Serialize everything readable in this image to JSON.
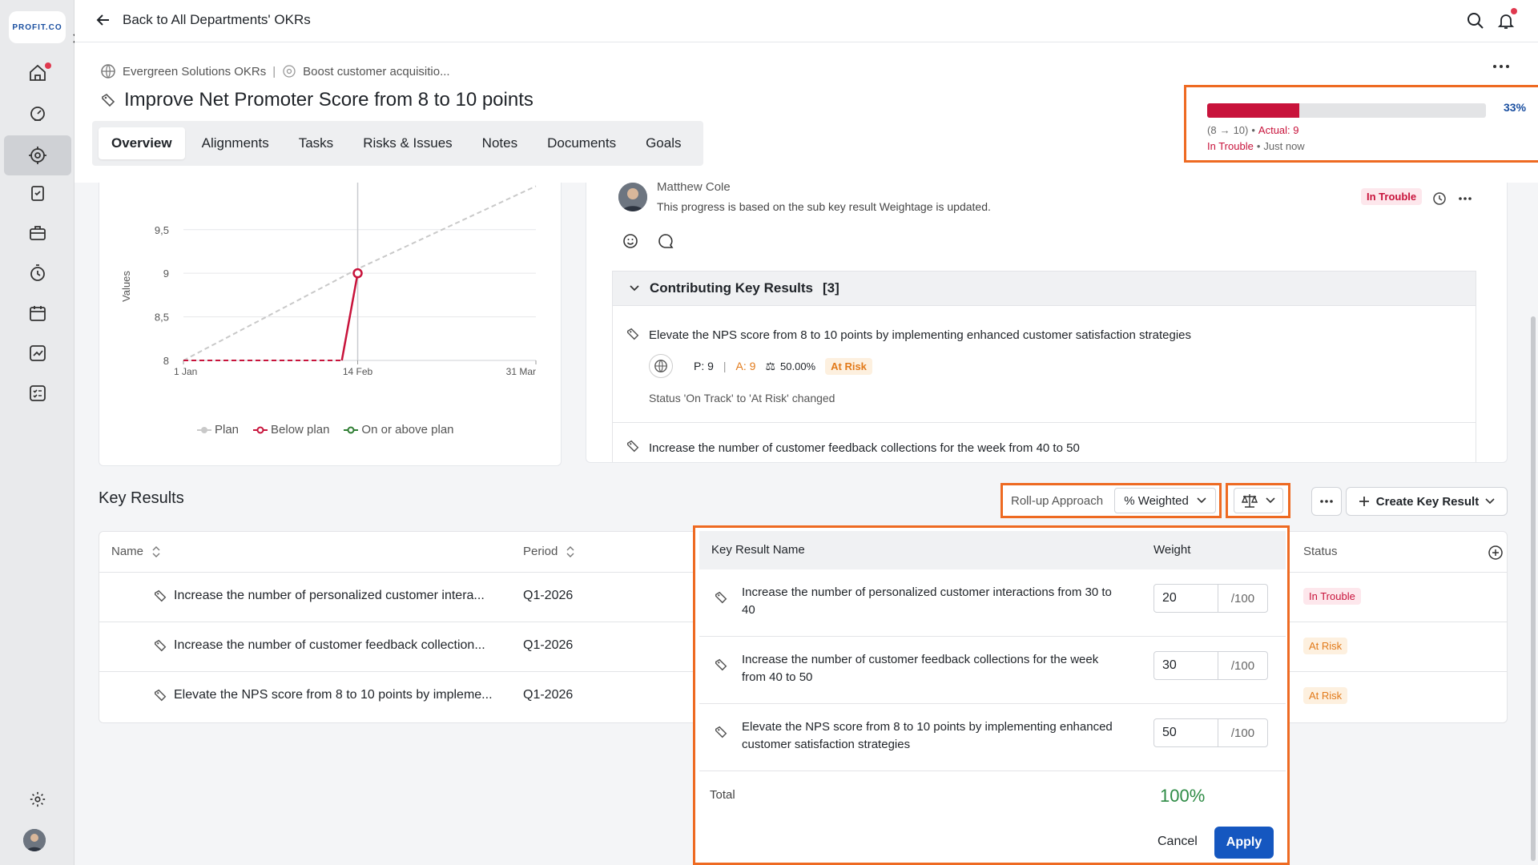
{
  "brand": {
    "logo_text": "PROFIT.CO"
  },
  "topbar": {
    "back_label": "Back to All Departments' OKRs"
  },
  "header": {
    "breadcrumb_org": "Evergreen Solutions OKRs",
    "breadcrumb_objective": "Boost customer acquisitio...",
    "title": "Improve Net Promoter Score from 8 to 10 points",
    "tabs": [
      "Overview",
      "Alignments",
      "Tasks",
      "Risks & Issues",
      "Notes",
      "Documents",
      "Goals"
    ],
    "active_tab": "Overview"
  },
  "progress": {
    "percent": 33,
    "percent_label": "33%",
    "range_open": "(8",
    "range_close": "10)",
    "actual_label": "Actual: 9",
    "status": "In Trouble",
    "updated": "Just now",
    "bar_color": "#c8133b"
  },
  "chart_data": {
    "type": "line",
    "ylabel": "Values",
    "ylim": [
      8,
      9.7
    ],
    "yticks": [
      "8",
      "8,5",
      "9",
      "9,5"
    ],
    "xticks": [
      "1 Jan",
      "14 Feb",
      "31 Mar"
    ],
    "series": [
      {
        "name": "Plan",
        "color": "#c9c9c9",
        "points": [
          [
            "1 Jan",
            8
          ],
          [
            "14 Feb",
            9.05
          ],
          [
            "31 Mar",
            10
          ]
        ]
      },
      {
        "name": "Below plan",
        "color": "#c8133b",
        "points": [
          [
            "1 Jan",
            8
          ],
          [
            "10 Feb",
            8
          ],
          [
            "14 Feb",
            9
          ]
        ]
      },
      {
        "name": "On or above plan",
        "color": "#2e7d32",
        "points": []
      }
    ],
    "legend": [
      "Plan",
      "Below plan",
      "On or above plan"
    ],
    "legend_position": "bottom"
  },
  "activity": {
    "author": "Matthew Cole",
    "message": "This progress is based on the sub key result Weightage is updated.",
    "status_badge": "In Trouble",
    "contributing_title": "Contributing Key Results",
    "contributing_count": "[3]",
    "items": [
      {
        "name": "Elevate the NPS score from 8 to 10 points by implementing enhanced customer satisfaction strategies",
        "plan": "P: 9",
        "actual": "A: 9",
        "weight": "50.00%",
        "status": "At Risk",
        "change": "Status 'On Track' to 'At Risk' changed"
      },
      {
        "name": "Increase the number of customer feedback collections for the week from 40 to 50"
      }
    ]
  },
  "key_results": {
    "title": "Key Results",
    "rollup_label": "Roll-up Approach",
    "rollup_value": "% Weighted",
    "create_label": "Create Key Result",
    "columns": {
      "name": "Name",
      "period": "Period",
      "status": "Status"
    },
    "rows": [
      {
        "name": "Increase the number of personalized customer intera...",
        "period": "Q1-2026",
        "status": "In Trouble"
      },
      {
        "name": "Increase the number of customer feedback collection...",
        "period": "Q1-2026",
        "status": "At Risk"
      },
      {
        "name": "Elevate the NPS score from 8 to 10 points by impleme...",
        "period": "Q1-2026",
        "status": "At Risk"
      }
    ]
  },
  "weights": {
    "col_name": "Key Result Name",
    "col_weight": "Weight",
    "suffix": "/100",
    "rows": [
      {
        "name": "Increase the number of personalized customer interactions from 30 to 40",
        "weight": "20"
      },
      {
        "name": "Increase the number of customer feedback collections for the week from 40 to 50",
        "weight": "30"
      },
      {
        "name": "Elevate the NPS score from 8 to 10 points by implementing enhanced customer satisfaction strategies",
        "weight": "50"
      }
    ],
    "total_label": "Total",
    "total_value": "100%",
    "cancel_label": "Cancel",
    "apply_label": "Apply"
  }
}
